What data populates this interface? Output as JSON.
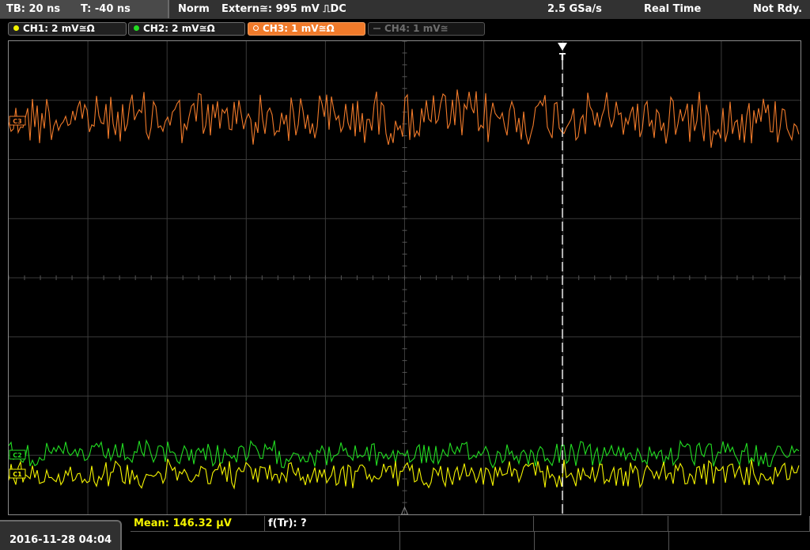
{
  "topbar": {
    "timebase": "TB: 20 ns",
    "trigger_offset": "T: -40 ns",
    "mode": "Norm",
    "trigger_source": "Extern≅: 995 mV ⎍DC",
    "sample_rate": "2.5 GSa/s",
    "acq_mode": "Real Time",
    "status": "Not Rdy."
  },
  "channels": [
    {
      "label": "CH1: 2 mV≅Ω",
      "color": "#f4f400"
    },
    {
      "label": "CH2: 2 mV≅Ω",
      "color": "#22dd22"
    },
    {
      "label": "CH3: 1 mV≅Ω",
      "color": "#f07a2a"
    },
    {
      "label": "CH4: 1 mV≅",
      "color": "#6e6e6e"
    }
  ],
  "markers": {
    "trigger": "T",
    "ch3": "C3",
    "ch2": "C2",
    "ch1": "C1"
  },
  "bottom": {
    "datetime": "2016-11-28 04:04",
    "mean": "Mean: 146.32 µV",
    "ftr": "f(Tr): ?"
  },
  "colors": {
    "ch1": "#f4f400",
    "ch2": "#22dd22",
    "ch3": "#f07a2a",
    "grid": "#3a3a3a"
  }
}
